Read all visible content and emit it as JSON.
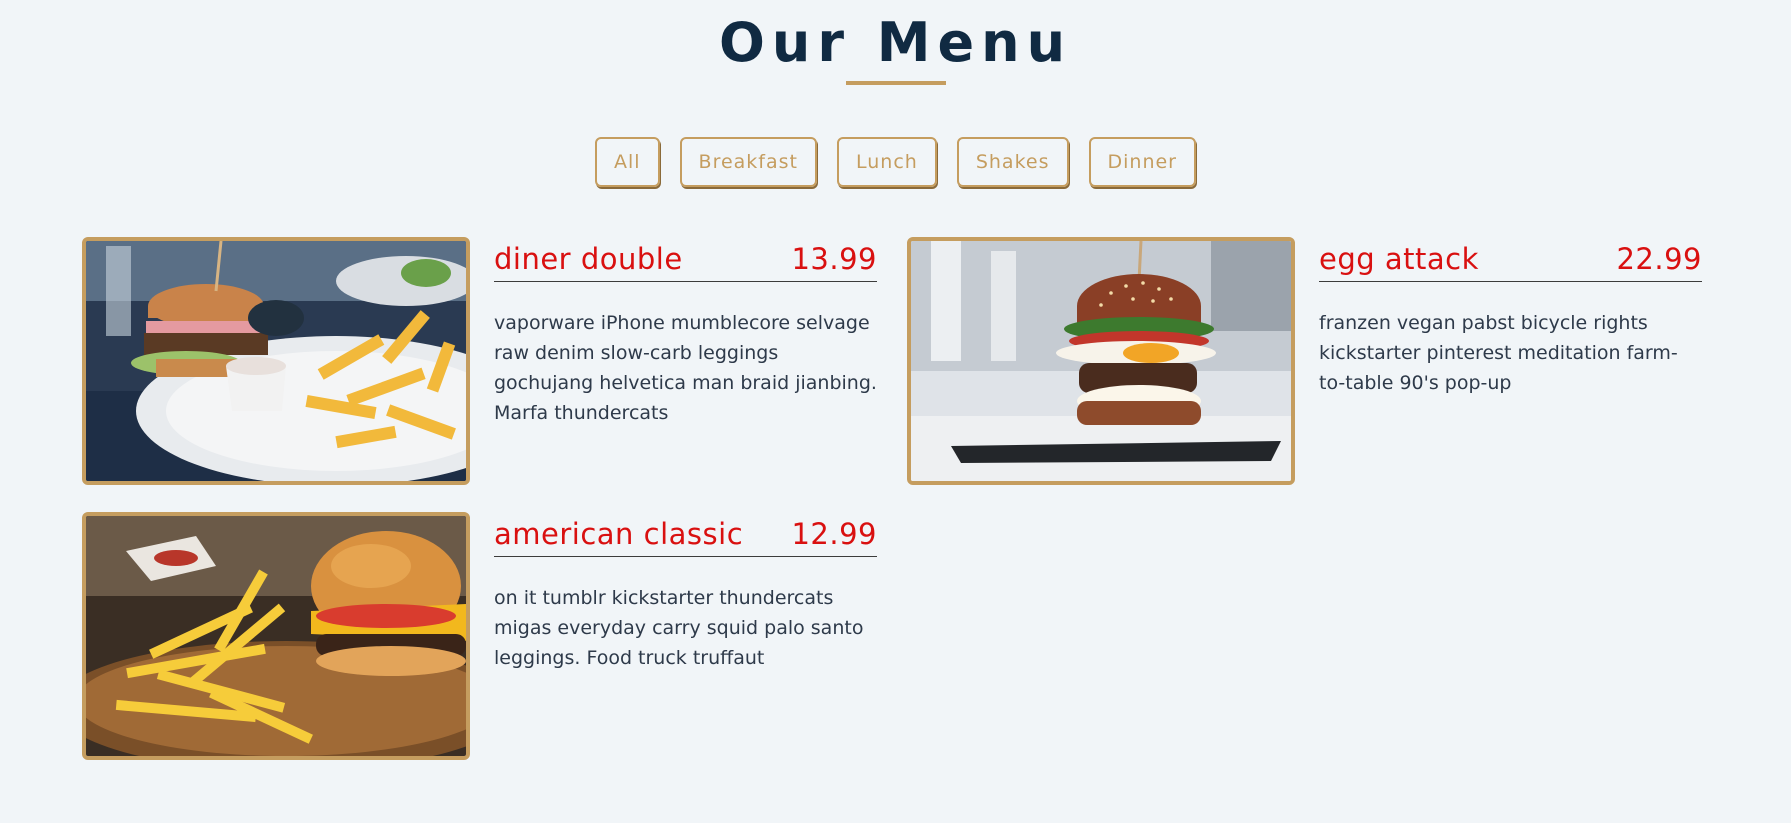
{
  "page_title": "Our Menu",
  "filters": [
    "All",
    "Breakfast",
    "Lunch",
    "Shakes",
    "Dinner"
  ],
  "accent_color": "#c59d5f",
  "price_color": "#d91010",
  "items": [
    {
      "name": "diner double",
      "price": "13.99",
      "description": "vaporware iPhone mumblecore selvage raw denim slow-carb leggings gochujang helvetica man braid jianbing. Marfa thundercats",
      "image": "burger-and-fries-plate-photo"
    },
    {
      "name": "egg attack",
      "price": "22.99",
      "description": "franzen vegan pabst bicycle rights kickstarter pinterest meditation farm-to-table 90's pop-up",
      "image": "egg-burger-photo"
    },
    {
      "name": "american classic",
      "price": "12.99",
      "description": "on it tumblr kickstarter thundercats migas everyday carry squid palo santo leggings. Food truck truffaut",
      "image": "cheeseburger-and-fries-board-photo"
    }
  ]
}
